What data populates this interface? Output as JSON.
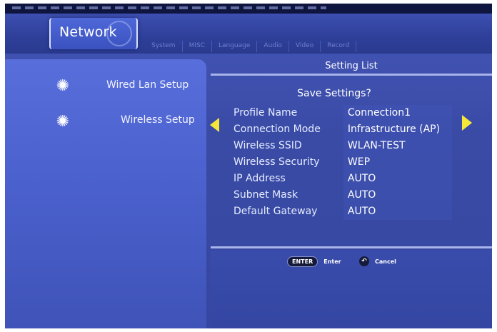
{
  "tabs": {
    "active": "Network",
    "others": [
      "System",
      "MISC",
      "Language",
      "Audio",
      "Video",
      "Record"
    ]
  },
  "left_menu": {
    "items": [
      {
        "label": "Wired Lan Setup",
        "icon": "sun-icon"
      },
      {
        "label": "Wireless Setup",
        "icon": "sun-icon"
      }
    ]
  },
  "panel": {
    "header": "Setting List",
    "dialog_title": "Save Settings?",
    "rows": [
      {
        "key": "Profile Name",
        "value": "Connection1"
      },
      {
        "key": "Connection Mode",
        "value": "Infrastructure (AP)"
      },
      {
        "key": "Wireless SSID",
        "value": "WLAN-TEST"
      },
      {
        "key": "Wireless Security",
        "value": "WEP"
      },
      {
        "key": "IP Address",
        "value": "AUTO"
      },
      {
        "key": "Subnet Mask",
        "value": "AUTO"
      },
      {
        "key": "Default Gateway",
        "value": "AUTO"
      }
    ]
  },
  "footer": {
    "enter_key": "ENTER",
    "enter_label": "Enter",
    "cancel_icon": "return-icon",
    "cancel_label": "Cancel"
  },
  "colors": {
    "background": "#3a4ba6",
    "accent_arrow": "#f4e73a",
    "text": "#ffffff"
  }
}
